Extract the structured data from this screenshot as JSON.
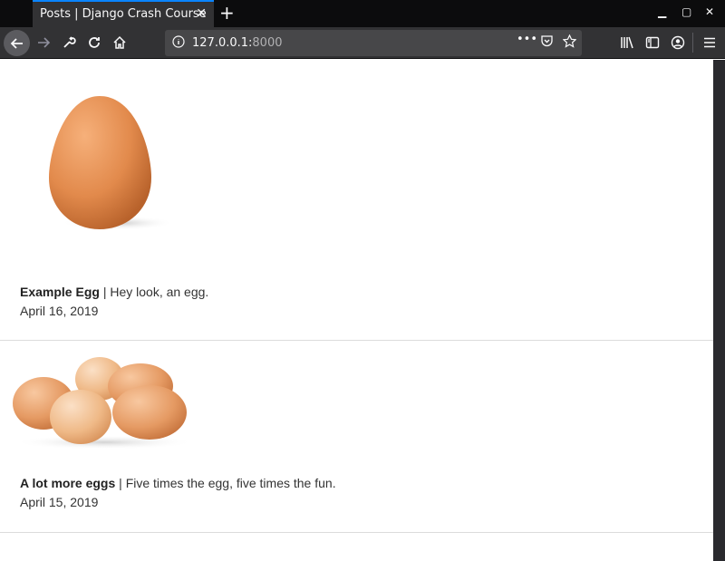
{
  "browser": {
    "tab_title": "Posts | Django Crash Course",
    "url_host": "127.0.0.1:",
    "url_port": "8000",
    "page_actions_dots": "•••"
  },
  "posts": [
    {
      "title": "Example Egg",
      "separator": "|",
      "description": "Hey look, an egg.",
      "date": "April 16, 2019"
    },
    {
      "title": "A lot more eggs",
      "separator": "|",
      "description": "Five times the egg, five times the fun.",
      "date": "April 15, 2019"
    }
  ]
}
